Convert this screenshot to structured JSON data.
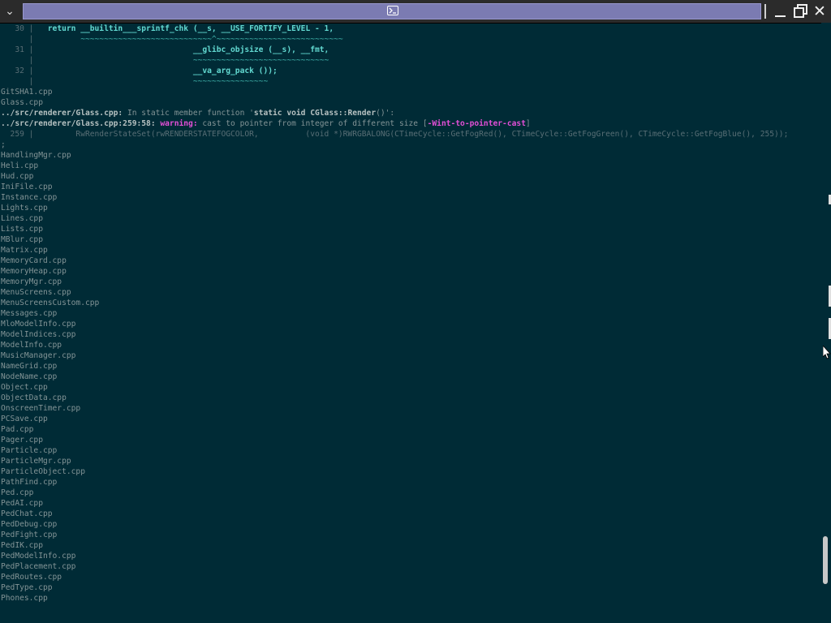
{
  "window": {
    "menu_icon": "chevron-down-icon",
    "title_icon": "terminal-icon",
    "title_glyph": "▣",
    "minimize_icon": "minimize-icon",
    "maximize_icon": "maximize-icon",
    "close_icon": "close-icon",
    "close_glyph": "✕",
    "menu_glyph": "⌄",
    "accent_color": "#7b7bb2"
  },
  "terminal": {
    "background": "#002b36",
    "code_context": [
      {
        "gutter": "   30 |",
        "code": "   return __builtin___sprintf_chk (__s, __USE_FORTIFY_LEVEL - 1,"
      },
      {
        "gutter": "      |",
        "code": "          ~~~~~~~~~~~~~~~~~~~~~~~~~~~~^~~~~~~~~~~~~~~~~~~~~~~~~~~~"
      },
      {
        "gutter": "   31 |",
        "code": "                                  __glibc_objsize (__s), __fmt,"
      },
      {
        "gutter": "      |",
        "code": "                                  ~~~~~~~~~~~~~~~~~~~~~~~~~~~~~"
      },
      {
        "gutter": "   32 |",
        "code": "                                  __va_arg_pack ());"
      },
      {
        "gutter": "      |",
        "code": "                                  ~~~~~~~~~~~~~~~~"
      }
    ],
    "files_before": [
      "GitSHA1.cpp",
      "Glass.cpp"
    ],
    "diagnostic": {
      "function_path": "../src/renderer/Glass.cpp:",
      "function_text": " In static member function '",
      "function_sig": "static void CGlass::Render",
      "function_end": "()':",
      "warning_loc": "../src/renderer/Glass.cpp:259:58:",
      "warning_label": " warning:",
      "warning_text": " cast to pointer from integer of different size [",
      "warning_flag": "-Wint-to-pointer-cast",
      "warning_close": "]",
      "source_line": "  259 |         RwRenderStateSet(rwRENDERSTATEFOGCOLOR,          (void *)RWRGBALONG(CTimeCycle::GetFogRed(), CTimeCycle::GetFogGreen(), CTimeCycle::GetFogBlue(), 255));",
      "semicolon_line": ";"
    },
    "files_after": [
      "HandlingMgr.cpp",
      "Heli.cpp",
      "Hud.cpp",
      "IniFile.cpp",
      "Instance.cpp",
      "Lights.cpp",
      "Lines.cpp",
      "Lists.cpp",
      "MBlur.cpp",
      "Matrix.cpp",
      "MemoryCard.cpp",
      "MemoryHeap.cpp",
      "MemoryMgr.cpp",
      "MenuScreens.cpp",
      "MenuScreensCustom.cpp",
      "Messages.cpp",
      "MloModelInfo.cpp",
      "ModelIndices.cpp",
      "ModelInfo.cpp",
      "MusicManager.cpp",
      "NameGrid.cpp",
      "NodeName.cpp",
      "Object.cpp",
      "ObjectData.cpp",
      "OnscreenTimer.cpp",
      "PCSave.cpp",
      "Pad.cpp",
      "Pager.cpp",
      "Particle.cpp",
      "ParticleMgr.cpp",
      "ParticleObject.cpp",
      "PathFind.cpp",
      "Ped.cpp",
      "PedAI.cpp",
      "PedChat.cpp",
      "PedDebug.cpp",
      "PedFight.cpp",
      "PedIK.cpp",
      "PedModelInfo.cpp",
      "PedPlacement.cpp",
      "PedRoutes.cpp",
      "PedType.cpp",
      "Phones.cpp"
    ]
  },
  "scrollbar": {
    "position_fraction": 0.93,
    "thumb_fraction": 0.08
  }
}
